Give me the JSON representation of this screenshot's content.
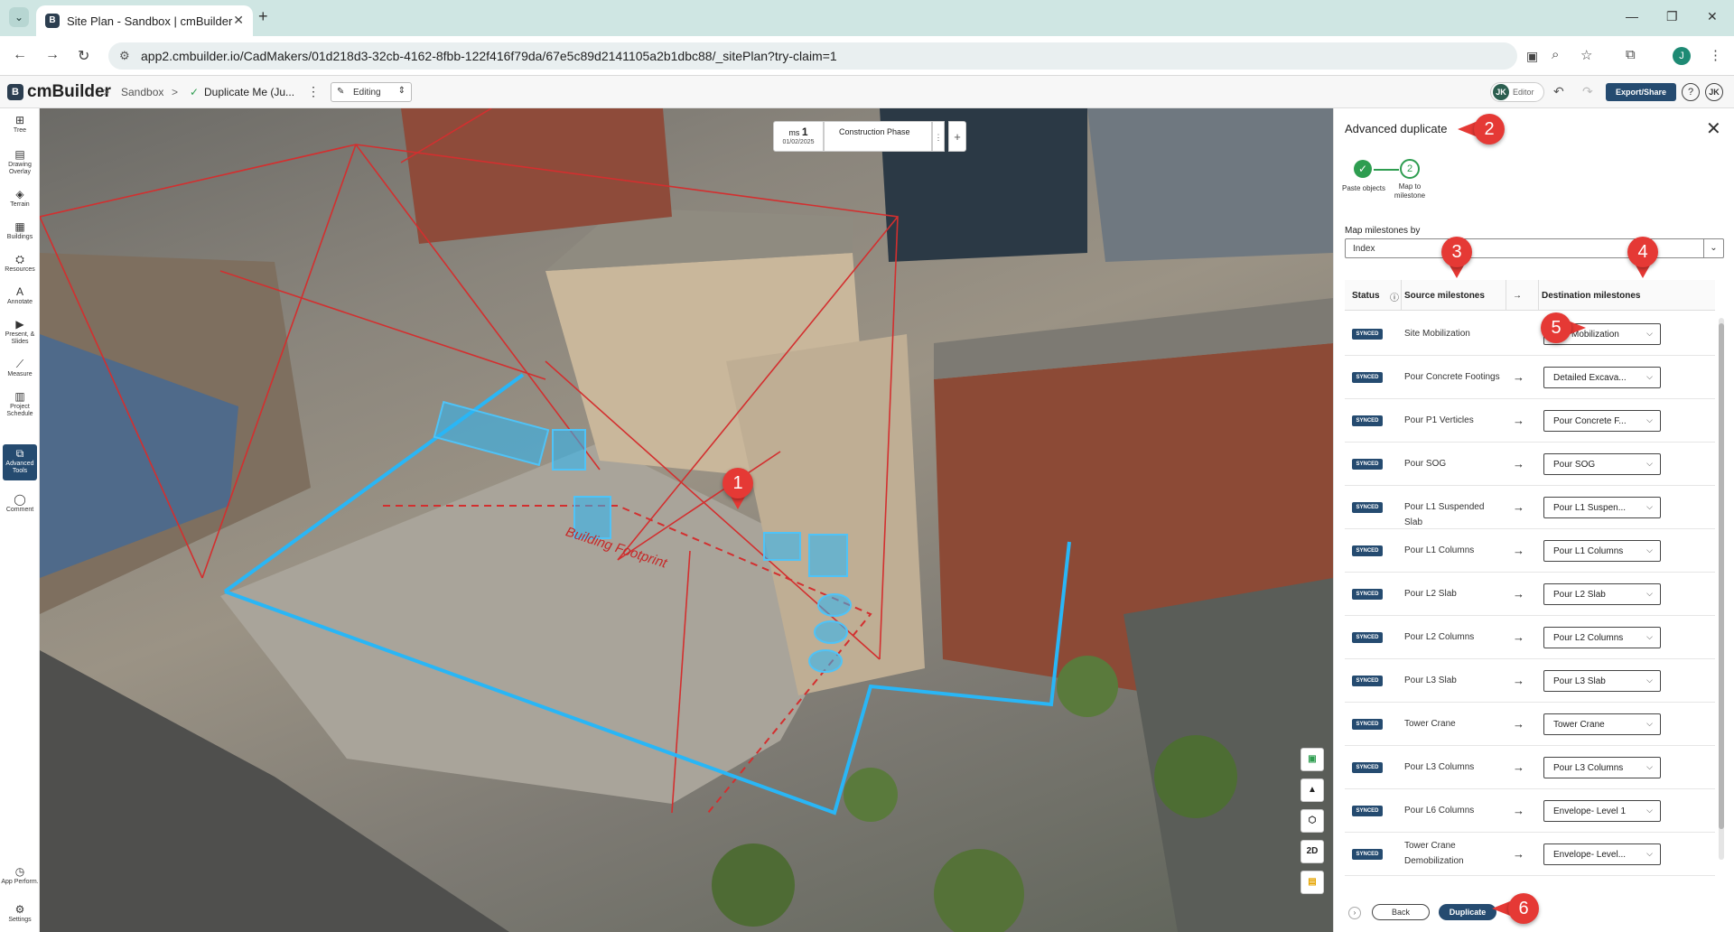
{
  "browser": {
    "tab_title": "Site Plan - Sandbox | cmBuilder",
    "url": "app2.cmbuilder.io/CadMakers/01d218d3-32cb-4162-8fbb-122f416f79da/67e5c89d2141105a2b1dbc88/_sitePlan?try-claim=1",
    "profile_initial": "J"
  },
  "app": {
    "logo_text": "cmBuilder",
    "breadcrumb": [
      "Sandbox",
      "Duplicate Me (Ju..."
    ],
    "mode_label": "Editing",
    "user_initials": "JK",
    "user_role": "Editor",
    "export_label": "Export/Share",
    "help_label": "?",
    "me_initials": "JK"
  },
  "sidebar": {
    "items": [
      {
        "label": "Tree",
        "icon": "tree-icon"
      },
      {
        "label": "Drawing Overlay",
        "icon": "drawing-overlay-icon"
      },
      {
        "label": "Terrain",
        "icon": "terrain-icon"
      },
      {
        "label": "Buildings",
        "icon": "buildings-icon"
      },
      {
        "label": "Resources",
        "icon": "resources-icon"
      },
      {
        "label": "Annotate",
        "icon": "annotate-icon"
      },
      {
        "label": "Present, & Slides",
        "icon": "present-icon"
      },
      {
        "label": "Measure",
        "icon": "measure-icon"
      },
      {
        "label": "Project Schedule",
        "icon": "schedule-icon"
      },
      {
        "label": "Advanced Tools",
        "icon": "advanced-tools-icon"
      },
      {
        "label": "Comment",
        "icon": "comment-icon"
      }
    ],
    "bottom_items": [
      {
        "label": "App Perform.",
        "icon": "performance-icon"
      },
      {
        "label": "Settings",
        "icon": "settings-icon"
      }
    ]
  },
  "viewport": {
    "milestone_prefix": "ms",
    "milestone_number": "1",
    "milestone_date": "01/02/2025",
    "phase_label": "Construction Phase",
    "footprint_label": "Building Footprint",
    "view_2d_label": "2D"
  },
  "panel": {
    "title": "Advanced duplicate",
    "steps": [
      {
        "number": "1",
        "label": "Paste objects",
        "done": true
      },
      {
        "number": "2",
        "label": "Map to milestone",
        "done": false
      }
    ],
    "map_by_label": "Map milestones by",
    "map_by_value": "Index",
    "columns": {
      "status": "Status",
      "source": "Source milestones",
      "arrow": "→",
      "destination": "Destination milestones"
    },
    "rows": [
      {
        "status": "SYNCED",
        "source": "Site Mobilization",
        "arrow": "",
        "destination": "Site Mobilization"
      },
      {
        "status": "SYNCED",
        "source": "Pour Concrete Footings",
        "arrow": "→",
        "destination": "Detailed Excava..."
      },
      {
        "status": "SYNCED",
        "source": "Pour P1 Verticles",
        "arrow": "→",
        "destination": "Pour Concrete F..."
      },
      {
        "status": "SYNCED",
        "source": "Pour SOG",
        "arrow": "→",
        "destination": "Pour SOG"
      },
      {
        "status": "SYNCED",
        "source": "Pour L1 Suspended Slab",
        "arrow": "→",
        "destination": "Pour L1 Suspen..."
      },
      {
        "status": "SYNCED",
        "source": "Pour L1 Columns",
        "arrow": "→",
        "destination": "Pour L1 Columns"
      },
      {
        "status": "SYNCED",
        "source": "Pour L2 Slab",
        "arrow": "→",
        "destination": "Pour L2 Slab"
      },
      {
        "status": "SYNCED",
        "source": "Pour L2 Columns",
        "arrow": "→",
        "destination": "Pour L2 Columns"
      },
      {
        "status": "SYNCED",
        "source": "Pour L3 Slab",
        "arrow": "→",
        "destination": "Pour L3 Slab"
      },
      {
        "status": "SYNCED",
        "source": "Tower Crane",
        "arrow": "→",
        "destination": "Tower Crane"
      },
      {
        "status": "SYNCED",
        "source": "Pour L3 Columns",
        "arrow": "→",
        "destination": "Pour L3 Columns"
      },
      {
        "status": "SYNCED",
        "source": "Pour L6 Columns",
        "arrow": "→",
        "destination": "Envelope- Level 1"
      },
      {
        "status": "SYNCED",
        "source": "Tower Crane Demobilization",
        "arrow": "→",
        "destination": "Envelope- Level..."
      }
    ],
    "back_label": "Back",
    "duplicate_label": "Duplicate"
  },
  "callouts": [
    "1",
    "2",
    "3",
    "4",
    "5",
    "6"
  ],
  "colors": {
    "accent": "#254b70",
    "success": "#2e9d50",
    "callout": "#e53935",
    "overlay_red": "#d32f2f",
    "overlay_cyan": "#29b6f6"
  }
}
